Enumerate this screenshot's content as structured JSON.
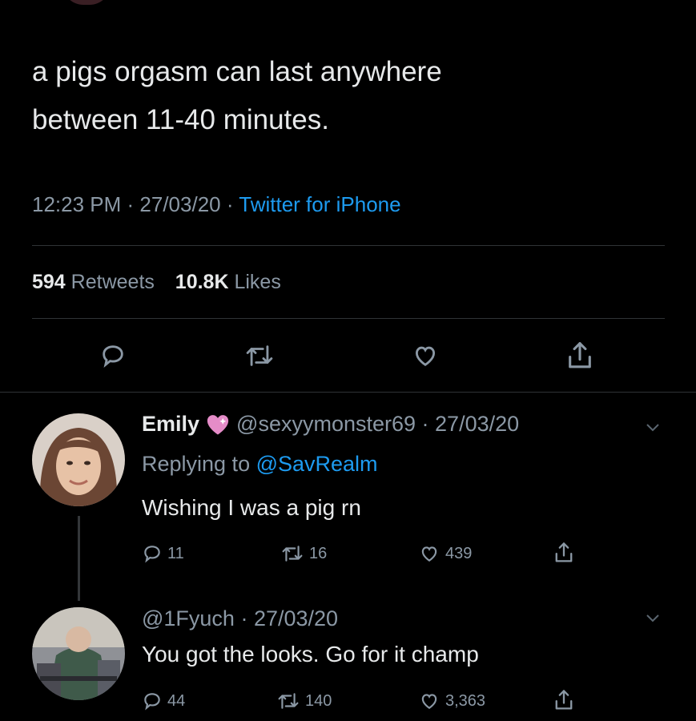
{
  "main_tweet": {
    "text_line1": "a pigs orgasm can last anywhere",
    "text_line2": "between 11-40 minutes.",
    "time": "12:23 PM",
    "sep1": " · ",
    "date": "27/03/20",
    "sep2": " · ",
    "source": "Twitter for iPhone",
    "retweets_count": "594",
    "retweets_label": "Retweets",
    "likes_count": "10.8K",
    "likes_label": "Likes"
  },
  "reply1": {
    "name": "Emily",
    "handle_date": "@sexyymonster69 · 27/03/20",
    "replying_to_label": "Replying to ",
    "replying_to_handle": "@SavRealm",
    "text": "Wishing I was a pig rn",
    "replies": "11",
    "retweets": "16",
    "likes": "439"
  },
  "reply2": {
    "handle_date": "@1Fyuch · 27/03/20",
    "text": "You got the looks. Go for it champ",
    "replies": "44",
    "retweets": "140",
    "likes": "3,363"
  },
  "colors": {
    "background": "#000000",
    "accent": "#1d9bf0",
    "muted": "#8b98a5",
    "heart_emoji": "#e58cc8"
  }
}
